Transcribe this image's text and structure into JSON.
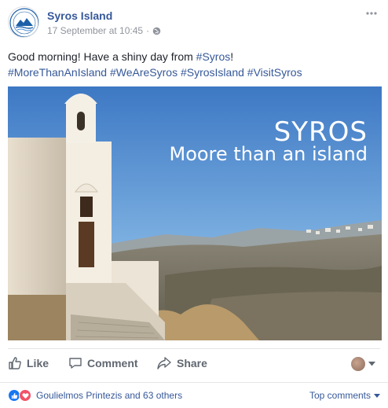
{
  "post": {
    "page_name": "Syros Island",
    "timestamp": "17 September at 10:45",
    "separator": "·",
    "text_prefix": "Good morning! Have a shiny day from ",
    "text_hashtag": "#Syros",
    "text_suffix": "!",
    "hashtags": [
      "#MoreThanAnIsland",
      "#WeAreSyros",
      "#SyrosIsland",
      "#VisitSyros"
    ],
    "image": {
      "title": "SYROS",
      "subtitle": "Moore than an island"
    }
  },
  "actions": {
    "like_label": "Like",
    "comment_label": "Comment",
    "share_label": "Share"
  },
  "reactions": {
    "summary": "Goulielmos Printezis and 63 others",
    "top_comments_label": "Top comments"
  },
  "icons": {
    "more": "more-dots-icon",
    "privacy": "globe-icon",
    "like": "thumbs-up-icon",
    "comment": "comment-bubble-icon",
    "share": "share-arrow-icon",
    "reaction_like": "like-reaction-icon",
    "reaction_love": "love-reaction-icon",
    "dropdown": "caret-down-icon"
  },
  "colors": {
    "link": "#365899",
    "meta": "#90949c",
    "action": "#606770",
    "like_blue": "#1877f2",
    "love_red": "#f25268"
  }
}
